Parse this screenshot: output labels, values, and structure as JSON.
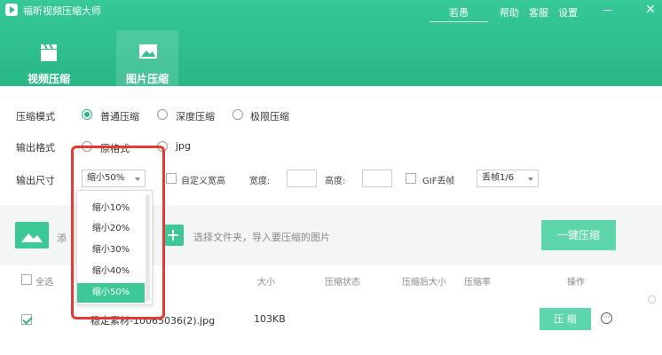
{
  "app": {
    "title": "福昕视频压缩大师"
  },
  "header": {
    "user": "若愚",
    "menu": [
      "帮助",
      "客服",
      "设置"
    ],
    "window_controls": {
      "minimize": "minimize-icon",
      "maximize": "maximize-icon",
      "close": "✕"
    }
  },
  "tabs": [
    {
      "label": "视频压缩",
      "icon": "clapperboard-icon",
      "active": false
    },
    {
      "label": "图片压缩",
      "icon": "image-icon",
      "active": true
    }
  ],
  "settings": {
    "mode": {
      "label": "压缩模式",
      "options": [
        "普通压缩",
        "深度压缩",
        "极限压缩"
      ],
      "selected": "普通压缩"
    },
    "format": {
      "label": "输出格式",
      "options": [
        "原格式",
        "jpg"
      ]
    },
    "size": {
      "label": "输出尺寸",
      "selected": "缩小50%",
      "custom_label": "自定义宽高",
      "width_label": "宽度:",
      "height_label": "高度:",
      "gif_label": "GIF丢帧",
      "gif_value": "丢帧1/6"
    }
  },
  "dropdown": {
    "options": [
      "缩小10%",
      "缩小20%",
      "缩小30%",
      "缩小40%",
      "缩小50%"
    ],
    "selected": "缩小50%"
  },
  "drop_area": {
    "add_image_label": "添",
    "add_folder_label": "选择文件夹，导入要压缩的图片",
    "compress_all": "一键压缩"
  },
  "table": {
    "select_all": "全选",
    "columns": [
      "大小",
      "压缩状态",
      "压缩后大小",
      "压缩率",
      "操作"
    ],
    "rows": [
      {
        "checked": true,
        "name": "稳定素材-10065036(2).jpg",
        "size": "103KB",
        "action": "压 缩",
        "more": "···"
      }
    ]
  },
  "colors": {
    "brand": "#2bbb89",
    "button": "#5cd6aa",
    "highlight": "#e53935"
  }
}
